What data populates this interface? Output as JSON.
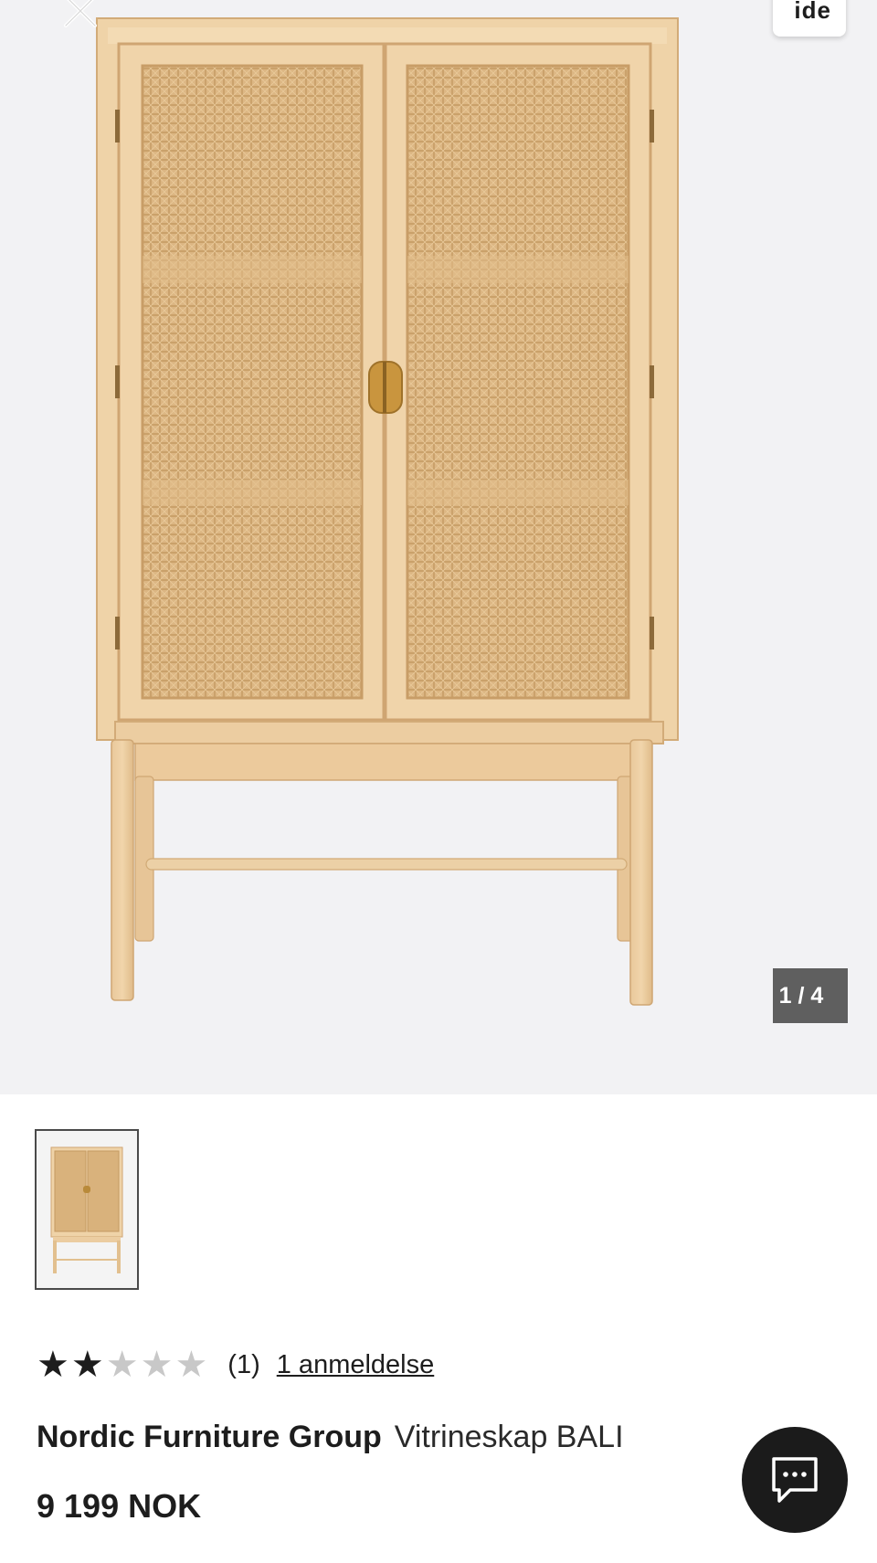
{
  "gallery": {
    "image_alt": "Nordic Furniture Group Vitrineskap BALI",
    "counter": "1 / 4",
    "overlay_chip_text": "ide",
    "close_icon": "close-icon"
  },
  "thumbnails": [
    {
      "alt": "Vitrineskap BALI thumbnail 1",
      "selected": true
    }
  ],
  "rating": {
    "value": 2,
    "max": 5,
    "count_text": "(1)",
    "link_text": "1 anmeldelse"
  },
  "product": {
    "brand": "Nordic Furniture Group",
    "name": "Vitrineskap BALI",
    "price": "9 199 NOK"
  },
  "chat": {
    "icon": "chat-bubble-icon"
  },
  "colors": {
    "gallery_bg": "#f2f2f4",
    "wood": "#e8c79a",
    "rattan": "#d9b27c",
    "brass": "#c9953e",
    "text": "#1d1d1d",
    "star_empty": "#c8c8c8",
    "chat_bg": "#1b1b1b"
  }
}
